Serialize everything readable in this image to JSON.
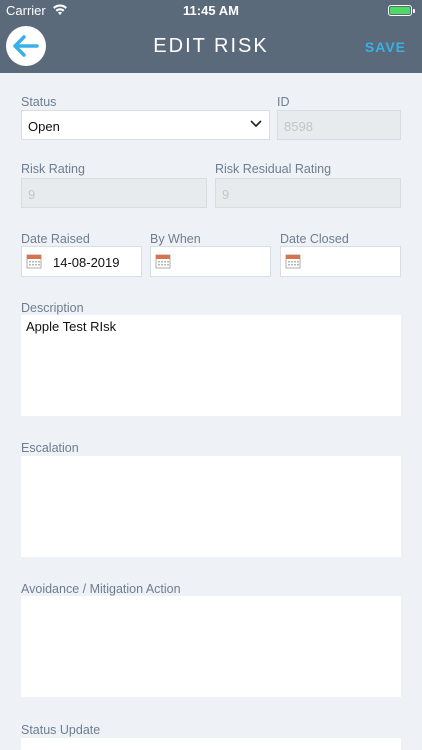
{
  "status_bar": {
    "carrier": "Carrier",
    "time": "11:45 AM",
    "battery_level": 1.0
  },
  "nav": {
    "title": "EDIT RISK",
    "save_label": "SAVE",
    "back_icon": "arrow-left-icon"
  },
  "form": {
    "status": {
      "label": "Status",
      "value": "Open"
    },
    "id": {
      "label": "ID",
      "value": "8598"
    },
    "risk_rating": {
      "label": "Risk Rating",
      "value": "9"
    },
    "risk_residual_rating": {
      "label": "Risk Residual Rating",
      "value": "9"
    },
    "date_raised": {
      "label": "Date Raised",
      "value": "14-08-2019"
    },
    "by_when": {
      "label": "By When",
      "value": ""
    },
    "date_closed": {
      "label": "Date Closed",
      "value": ""
    },
    "description": {
      "label": "Description",
      "value": "Apple Test RIsk"
    },
    "escalation": {
      "label": "Escalation",
      "value": ""
    },
    "mitigation": {
      "label": "Avoidance / Mitigation Action",
      "value": ""
    },
    "status_update": {
      "label": "Status Update",
      "value": ""
    }
  },
  "colors": {
    "header": "#5a6a7b",
    "accent": "#39b0e8",
    "background": "#eef2f7"
  }
}
